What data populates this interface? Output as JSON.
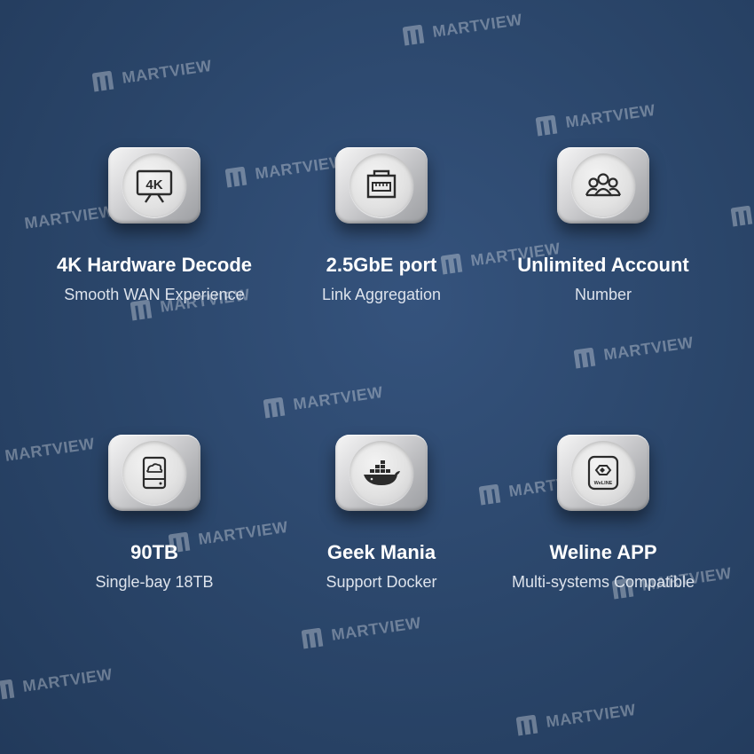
{
  "watermark_text": "MARTVIEW",
  "features": [
    {
      "title": "4K Hardware Decode",
      "subtitle": "Smooth WAN Experience",
      "icon": "4k-tv-icon"
    },
    {
      "title": "2.5GbE port",
      "subtitle": "Link Aggregation",
      "icon": "ethernet-port-icon"
    },
    {
      "title": "Unlimited Account",
      "subtitle": "Number",
      "icon": "user-group-icon"
    },
    {
      "title": "90TB",
      "subtitle": "Single-bay 18TB",
      "icon": "cloud-drive-icon"
    },
    {
      "title": "Geek Mania",
      "subtitle": "Support Docker",
      "icon": "docker-whale-icon"
    },
    {
      "title": "Weline APP",
      "subtitle": "Multi-systems Compatible",
      "icon": "weline-app-icon",
      "icon_label": "WeLINE"
    }
  ]
}
